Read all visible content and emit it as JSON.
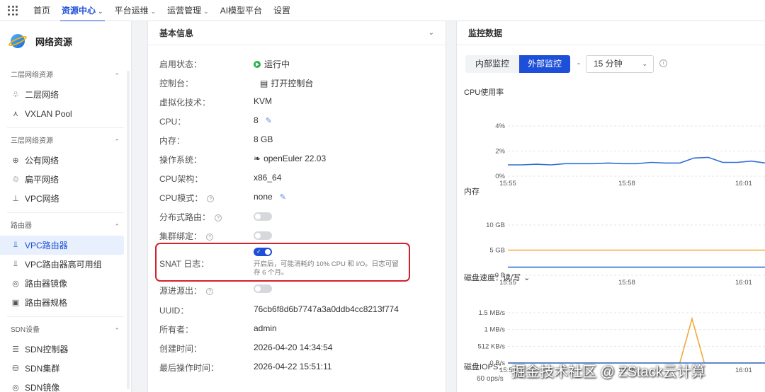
{
  "topnav": {
    "items": [
      {
        "label": "首页",
        "caret": false
      },
      {
        "label": "资源中心",
        "caret": true,
        "active": true
      },
      {
        "label": "平台运维",
        "caret": true
      },
      {
        "label": "运营管理",
        "caret": true
      },
      {
        "label": "AI模型平台",
        "caret": false
      },
      {
        "label": "设置",
        "caret": false
      }
    ]
  },
  "sidebar": {
    "title": "网络资源",
    "groups": [
      {
        "title": "二层网络资源",
        "items": [
          {
            "label": "二层网络",
            "icon": "hierarchy-icon"
          },
          {
            "label": "VXLAN Pool",
            "icon": "node-tree-icon"
          }
        ]
      },
      {
        "title": "三层网络资源",
        "items": [
          {
            "label": "公有网络",
            "icon": "globe-icon"
          },
          {
            "label": "扁平网络",
            "icon": "cycle-icon"
          },
          {
            "label": "VPC网络",
            "icon": "fork-icon"
          }
        ]
      },
      {
        "title": "路由器",
        "items": [
          {
            "label": "VPC路由器",
            "icon": "router-icon",
            "active": true
          },
          {
            "label": "VPC路由器高可用组",
            "icon": "router-ha-icon"
          },
          {
            "label": "路由器镜像",
            "icon": "disc-icon"
          },
          {
            "label": "路由器规格",
            "icon": "spec-icon"
          }
        ]
      },
      {
        "title": "SDN设备",
        "items": [
          {
            "label": "SDN控制器",
            "icon": "sliders-icon"
          },
          {
            "label": "SDN集群",
            "icon": "cluster-icon"
          },
          {
            "label": "SDN镜像",
            "icon": "disc-icon"
          }
        ]
      }
    ]
  },
  "info": {
    "title": "基本信息",
    "rows": [
      {
        "label": "启用状态：",
        "value": "运行中"
      },
      {
        "label": "控制台：",
        "value": "打开控制台"
      },
      {
        "label": "虚拟化技术：",
        "value": "KVM"
      },
      {
        "label": "CPU：",
        "value": "8"
      },
      {
        "label": "内存：",
        "value": "8 GB"
      },
      {
        "label": "操作系统：",
        "value": "openEuler 22.03"
      },
      {
        "label": "CPU架构：",
        "value": "x86_64"
      },
      {
        "label": "CPU模式：",
        "value": "none"
      },
      {
        "label": "分布式路由：",
        "value": ""
      },
      {
        "label": "集群绑定：",
        "value": ""
      },
      {
        "label": "SNAT 日志：",
        "value": ""
      },
      {
        "label": "源进源出：",
        "value": ""
      },
      {
        "label": "UUID：",
        "value": "76cb6f8d6b7747a3a0ddb4cc8213f774"
      },
      {
        "label": "所有者：",
        "value": "admin"
      },
      {
        "label": "创建时间：",
        "value": "2026-04-20 14:34:54"
      },
      {
        "label": "最后操作时间：",
        "value": "2026-04-22 15:51:11"
      }
    ],
    "snat_hint": "开启后，可能消耗约 10% CPU 和 I/O。日志可留存 6 个月。",
    "toggles": {
      "distributed_routing": false,
      "cluster_binding": false,
      "snat_log": true,
      "source_in_source_out": false
    }
  },
  "monitor": {
    "title": "监控数据",
    "tab_internal": "内部监控",
    "tab_external": "外部监控",
    "active_tab": "外部监控",
    "dash": "-",
    "interval": "15 分钟",
    "disk_dropdown_caret": "⌄",
    "colors": {
      "blue_series": "#2f6fd8",
      "orange_series": "#f2a93b",
      "accent": "#1d4fd8"
    }
  },
  "chart_data": [
    {
      "type": "line",
      "title": "CPU使用率",
      "x_ticks": [
        "15:55",
        "15:58",
        "16:01"
      ],
      "y_ticks": [
        "4%",
        "2%",
        "0%"
      ],
      "ylim": [
        0,
        4
      ],
      "series": [
        {
          "values": [
            0.9,
            0.9,
            0.95,
            0.9,
            1.0,
            1.0,
            1.0,
            1.05,
            1.0,
            1.0,
            1.1,
            1.05,
            1.05,
            1.45,
            1.5,
            1.1,
            1.1,
            1.2,
            1.05
          ]
        }
      ]
    },
    {
      "type": "line",
      "title": "内存",
      "x_ticks": [
        "15:55",
        "15:58",
        "16:01"
      ],
      "y_ticks": [
        "10 GB",
        "5 GB",
        "0 B"
      ],
      "ylim": [
        0,
        10
      ],
      "series": [
        {
          "values": [
            5.0,
            5.0,
            5.0,
            5.0,
            5.0,
            5.0,
            5.0,
            5.0,
            5.0,
            5.0,
            5.0,
            5.0,
            5.0,
            5.0,
            5.0,
            5.0,
            5.0,
            5.0,
            5.0
          ]
        },
        {
          "values": [
            1.6,
            1.6,
            1.6,
            1.6,
            1.6,
            1.6,
            1.6,
            1.6,
            1.6,
            1.6,
            1.6,
            1.6,
            1.6,
            1.6,
            1.6,
            1.6,
            1.6,
            1.6,
            1.6
          ]
        }
      ]
    },
    {
      "type": "line",
      "title": "磁盘速度：读/写",
      "x_ticks": [
        "15:55",
        "15:58",
        "16:01"
      ],
      "y_ticks": [
        "1.5 MB/s",
        "1 MB/s",
        "512 KB/s",
        "0 B/s"
      ],
      "ylim": [
        0,
        1.5
      ],
      "series": [
        {
          "values": [
            0,
            0,
            0,
            0,
            0,
            0,
            0,
            0,
            0,
            0,
            0,
            0,
            0,
            0,
            0,
            1.32,
            0,
            0,
            0,
            0,
            0,
            0
          ]
        },
        {
          "values": [
            0,
            0,
            0,
            0,
            0,
            0,
            0,
            0,
            0,
            0,
            0,
            0,
            0,
            0,
            0,
            0,
            0,
            0,
            0,
            0,
            0,
            0
          ]
        }
      ]
    },
    {
      "type": "line",
      "title": "磁盘IOPS：",
      "y_ticks": [
        "60 ops/s"
      ]
    }
  ],
  "watermark": "掘金技术社区 @ ZStack云计算"
}
